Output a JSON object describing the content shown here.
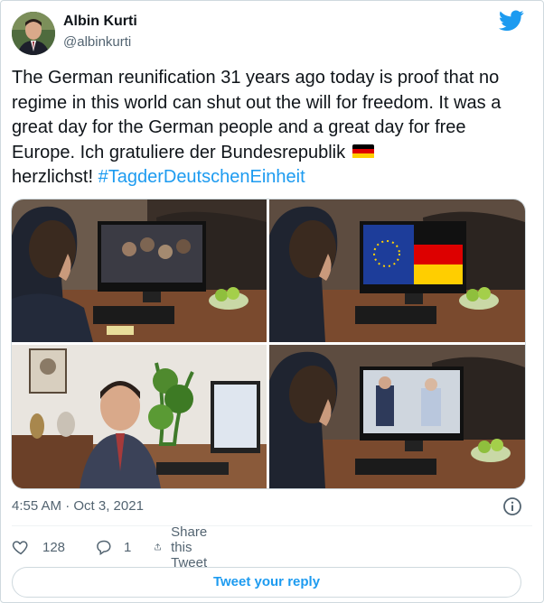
{
  "author": {
    "name": "Albin Kurti",
    "handle": "@albinkurti"
  },
  "tweet": {
    "text": "The German reunification 31 years ago today is proof that no regime in this world can shut out the will for freedom. It was a great day for the German people and a great day for free Europe. Ich gratuliere der Bundesrepublik",
    "text_tail": "herzlichst!",
    "hashtag": "#TagderDeutschenEinheit",
    "flag_colors": [
      "#000000",
      "#dd0000",
      "#ffce00"
    ]
  },
  "photos": [
    {
      "alt_icon": "photo-man-watching-video"
    },
    {
      "alt_icon": "photo-man-watching-flags"
    },
    {
      "alt_icon": "photo-man-at-desk"
    },
    {
      "alt_icon": "photo-man-video-call"
    }
  ],
  "meta": {
    "timestamp": "4:55 AM · Oct 3, 2021"
  },
  "actions": {
    "likes": "128",
    "replies": "1",
    "share_label": "Share this Tweet"
  },
  "reply_button": {
    "label": "Tweet your reply"
  },
  "colors": {
    "accent": "#1d9bf0",
    "secondary_text": "#536471",
    "border": "#cfd9de"
  }
}
